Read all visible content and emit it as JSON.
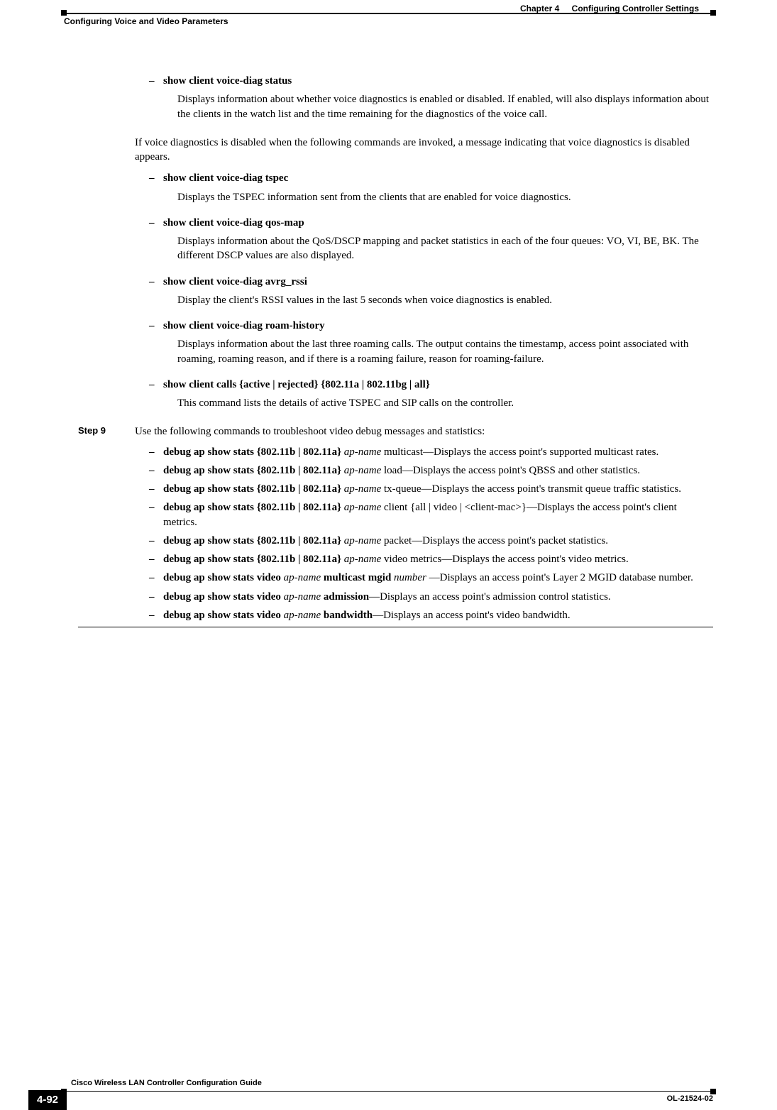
{
  "header": {
    "chapter_label": "Chapter 4",
    "chapter_title": "Configuring Controller Settings",
    "section_title": "Configuring Voice and Video Parameters"
  },
  "items_a": [
    {
      "cmd": "show client voice-diag status",
      "desc": "Displays information about whether voice diagnostics is enabled or disabled. If enabled, will also displays information about the clients in the watch list and the time remaining for the diagnostics of the voice call."
    }
  ],
  "mid_para": "If voice diagnostics is disabled when the following commands are invoked, a message indicating that voice diagnostics is disabled appears.",
  "items_b": [
    {
      "cmd": "show client voice-diag tspec",
      "desc": "Displays the TSPEC information sent from the clients that are enabled for voice diagnostics."
    },
    {
      "cmd": "show client voice-diag qos-map",
      "desc": "Displays information about the QoS/DSCP mapping and packet statistics in each of the four queues: VO, VI, BE, BK. The different DSCP values are also displayed."
    },
    {
      "cmd": "show client voice-diag avrg_rssi",
      "desc": "Display the client's RSSI values in the last 5 seconds when voice diagnostics is enabled."
    },
    {
      "cmd": "show client voice-diag roam-history",
      "desc": "Displays information about the last three roaming calls. The output contains the timestamp, access point associated with roaming, roaming reason, and if there is a roaming failure, reason for roaming-failure."
    },
    {
      "cmd": "show client calls {active | rejected} {802.11a | 802.11bg | all}",
      "desc": "This command lists the details of active TSPEC and SIP calls on the controller."
    }
  ],
  "step9": {
    "label": "Step 9",
    "intro": "Use the following commands to troubleshoot video debug messages and statistics:",
    "items": [
      {
        "pre": "debug ap show stats {802.11b | 802.11a} ",
        "arg": "ap-name",
        "post": " multicast—Displays the access point's supported multicast rates."
      },
      {
        "pre": "debug ap show stats {802.11b | 802.11a} ",
        "arg": "ap-name",
        "post": " load—Displays the access point's QBSS and other statistics."
      },
      {
        "pre": "debug ap show stats {802.11b | 802.11a} ",
        "arg": "ap-name",
        "post": " tx-queue—Displays the access point's transmit queue traffic statistics."
      },
      {
        "pre": "debug ap show stats {802.11b | 802.11a} ",
        "arg": "ap-name",
        "post_plain": " client {all | video | <client-mac>}—Displays the access point's client metrics."
      },
      {
        "pre": "debug ap show stats {802.11b | 802.11a} ",
        "arg": "ap-name",
        "post": " packet—Displays the access point's packet statistics."
      },
      {
        "pre": "debug ap show stats {802.11b | 802.11a} ",
        "arg": "ap-name",
        "post": " video metrics—Displays the access point's video metrics."
      },
      {
        "pre": "debug ap show stats video ",
        "arg": "ap-name",
        "mid_bold": " multicast mgid ",
        "arg2": "number",
        "post": " —Displays an access point's Layer 2 MGID database number."
      },
      {
        "pre": "debug ap show stats video ",
        "arg": "ap-name",
        "mid_bold": " admission",
        "post": "—Displays an access point's admission control statistics."
      },
      {
        "pre": "debug ap show stats video ",
        "arg": "ap-name",
        "mid_bold": " bandwidth",
        "post": "—Displays an access point's video bandwidth."
      }
    ]
  },
  "footer": {
    "guide_title": "Cisco Wireless LAN Controller Configuration Guide",
    "page_num": "4-92",
    "doc_id": "OL-21524-02"
  }
}
